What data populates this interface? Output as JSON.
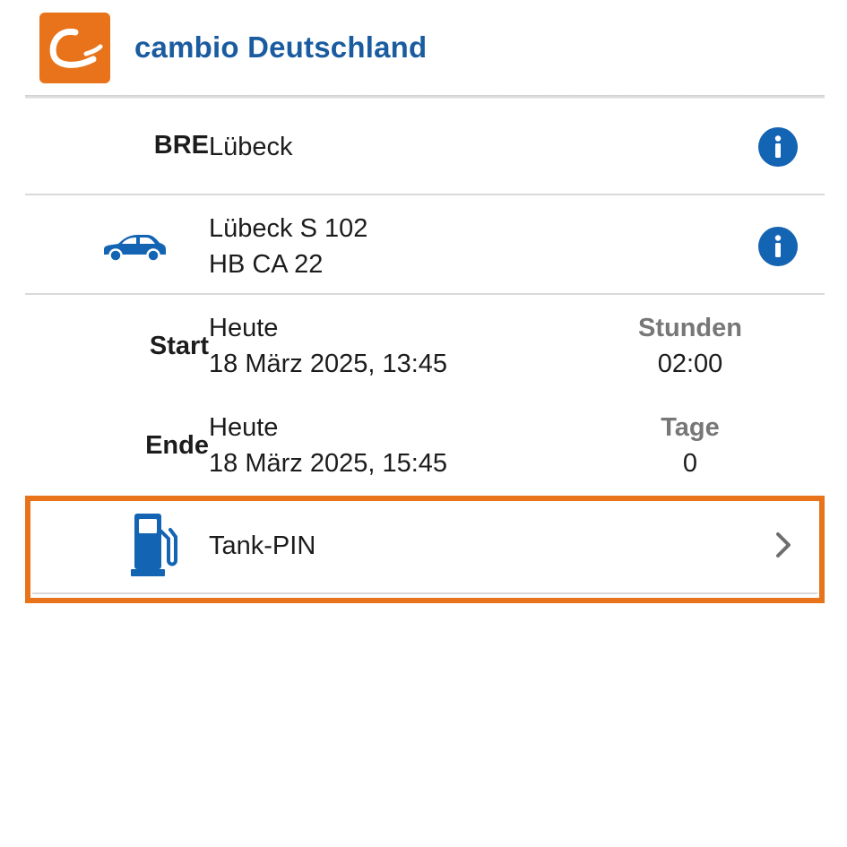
{
  "header": {
    "brand": "cambio Deutschland",
    "logo_icon": "cambio-logo",
    "accent_color": "#e8731a",
    "brand_color": "#1a5c9f"
  },
  "station": {
    "city_code": "BRE",
    "name": "Lübeck",
    "info_icon": "info-icon"
  },
  "vehicle": {
    "icon": "car-icon",
    "name": "Lübeck S 102",
    "plate": "HB CA 22",
    "info_icon": "info-icon"
  },
  "booking": {
    "start": {
      "label": "Start",
      "day": "Heute",
      "datetime": "18 März 2025, 13:45"
    },
    "end": {
      "label": "Ende",
      "day": "Heute",
      "datetime": "18 März 2025, 15:45"
    },
    "duration_hours": {
      "label": "Stunden",
      "value": "02:00"
    },
    "duration_days": {
      "label": "Tage",
      "value": "0"
    }
  },
  "tank_pin": {
    "icon": "fuel-pump-icon",
    "label": "Tank-PIN",
    "chevron_icon": "chevron-right-icon",
    "highlight_color": "#e8731a"
  }
}
